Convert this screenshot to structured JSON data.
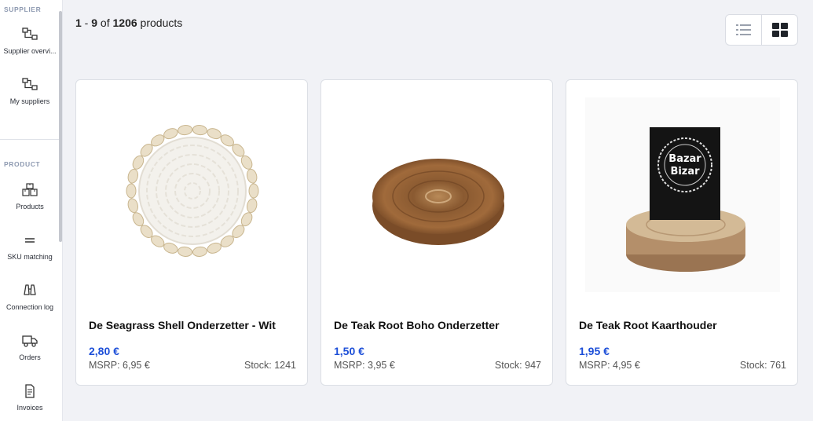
{
  "sidebar": {
    "supplier_section": "SUPPLIER",
    "product_section": "PRODUCT",
    "items": [
      {
        "label": "Supplier overvi...",
        "icon": "hierarchy-icon"
      },
      {
        "label": "My suppliers",
        "icon": "hierarchy-icon"
      },
      {
        "label": "Products",
        "icon": "boxes-icon"
      },
      {
        "label": "SKU matching",
        "icon": "equals-icon"
      },
      {
        "label": "Connection log",
        "icon": "binoculars-icon"
      },
      {
        "label": "Orders",
        "icon": "truck-icon"
      },
      {
        "label": "Invoices",
        "icon": "document-icon"
      }
    ]
  },
  "results": {
    "start": "1",
    "sep": " - ",
    "end": "9",
    "of": " of ",
    "total": "1206",
    "suffix": " products"
  },
  "view_toggle": {
    "options": [
      "list-view",
      "grid-view"
    ],
    "active": "grid-view"
  },
  "colors": {
    "accent": "#1d4fd8",
    "background": "#f1f2f6"
  },
  "products": [
    {
      "title": "De Seagrass Shell Onderzetter - Wit",
      "price": "2,80 €",
      "msrp": "MSRP: 6,95 €",
      "stock": "Stock: 1241",
      "image": "seagrass-shell-coaster-image"
    },
    {
      "title": "De Teak Root Boho Onderzetter",
      "price": "1,50 €",
      "msrp": "MSRP: 3,95 €",
      "stock": "Stock: 947",
      "image": "teak-root-coaster-image"
    },
    {
      "title": "De Teak Root Kaarthouder",
      "price": "1,95 €",
      "msrp": "MSRP: 4,95 €",
      "stock": "Stock: 761",
      "image": "teak-root-card-holder-image"
    }
  ]
}
